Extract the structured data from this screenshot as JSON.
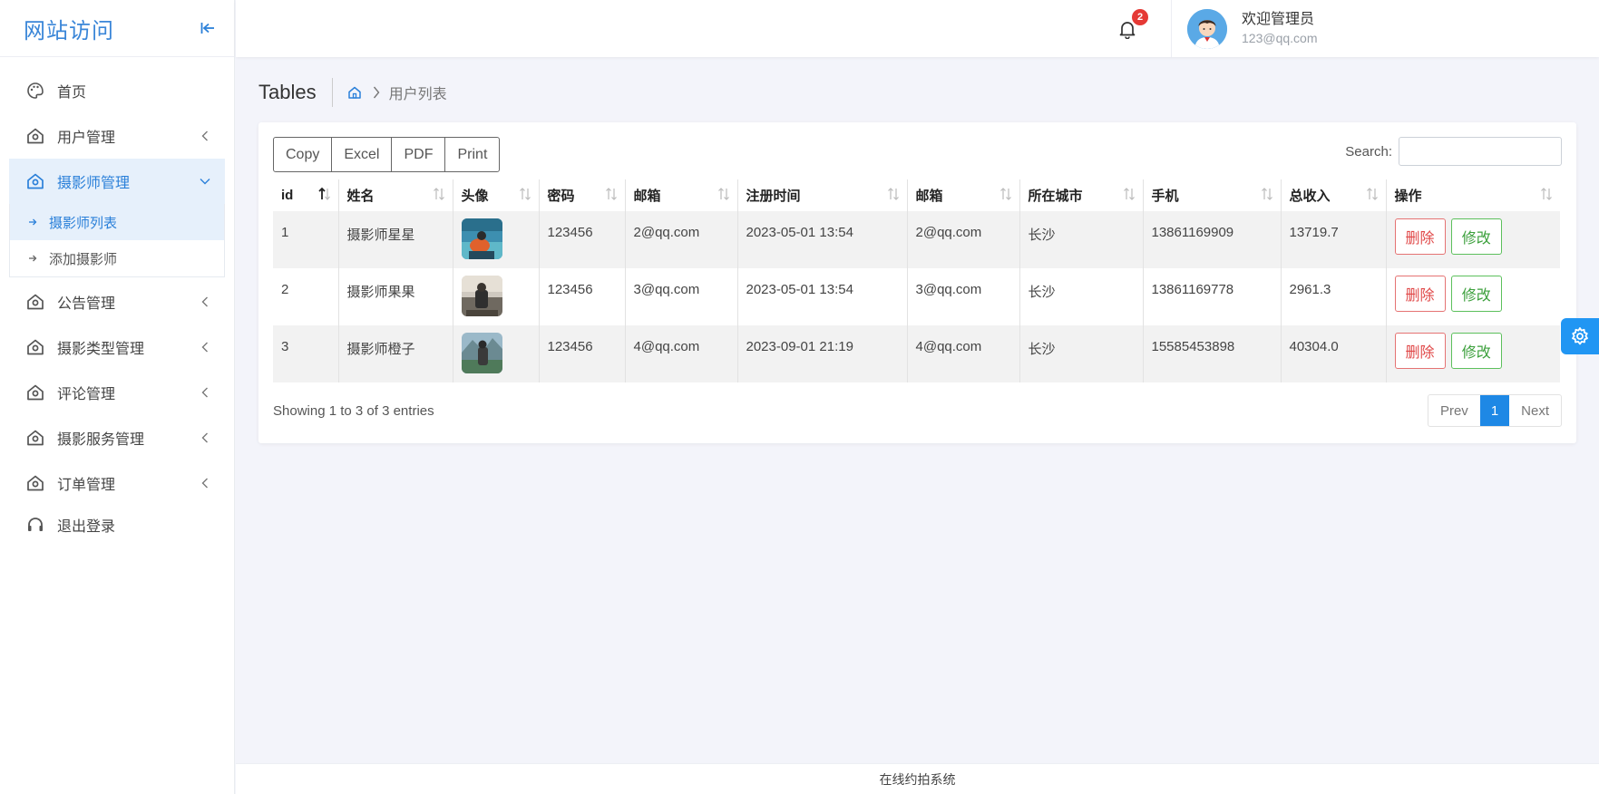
{
  "brand": {
    "title": "网站访问"
  },
  "sidebar": {
    "items": [
      {
        "label": "首页",
        "icon": "palette-icon"
      },
      {
        "label": "用户管理",
        "icon": "house-icon"
      },
      {
        "label": "摄影师管理",
        "icon": "house-icon"
      },
      {
        "label": "公告管理",
        "icon": "house-icon"
      },
      {
        "label": "摄影类型管理",
        "icon": "house-icon"
      },
      {
        "label": "评论管理",
        "icon": "house-icon"
      },
      {
        "label": "摄影服务管理",
        "icon": "house-icon"
      },
      {
        "label": "订单管理",
        "icon": "house-icon"
      },
      {
        "label": "退出登录",
        "icon": "headset-icon"
      }
    ],
    "submenu": [
      {
        "label": "摄影师列表"
      },
      {
        "label": "添加摄影师"
      }
    ],
    "active_color": "#2b80d9"
  },
  "header": {
    "notification_count": "2",
    "user_name": "欢迎管理员",
    "user_email": "123@qq.com"
  },
  "page": {
    "title": "Tables",
    "breadcrumb_current": "用户列表"
  },
  "toolbar": {
    "buttons": [
      "Copy",
      "Excel",
      "PDF",
      "Print"
    ],
    "search_label": "Search:"
  },
  "table": {
    "columns": [
      "id",
      "姓名",
      "头像",
      "密码",
      "邮箱",
      "注册时间",
      "邮箱",
      "所在城市",
      "手机",
      "总收入",
      "操作"
    ],
    "rows": [
      {
        "id": "1",
        "name": "摄影师星星",
        "password": "123456",
        "email": "2@qq.com",
        "registered": "2023-05-01 13:54",
        "email2": "2@qq.com",
        "city": "长沙",
        "phone": "13861169909",
        "income": "13719.7"
      },
      {
        "id": "2",
        "name": "摄影师果果",
        "password": "123456",
        "email": "3@qq.com",
        "registered": "2023-05-01 13:54",
        "email2": "3@qq.com",
        "city": "长沙",
        "phone": "13861169778",
        "income": "2961.3"
      },
      {
        "id": "3",
        "name": "摄影师橙子",
        "password": "123456",
        "email": "4@qq.com",
        "registered": "2023-09-01 21:19",
        "email2": "4@qq.com",
        "city": "长沙",
        "phone": "15585453898",
        "income": "40304.0"
      }
    ],
    "delete_label": "删除",
    "edit_label": "修改"
  },
  "pagination": {
    "info": "Showing 1 to 3 of 3 entries",
    "prev": "Prev",
    "current": "1",
    "next": "Next"
  },
  "footer": {
    "text": "在线约拍系统"
  }
}
